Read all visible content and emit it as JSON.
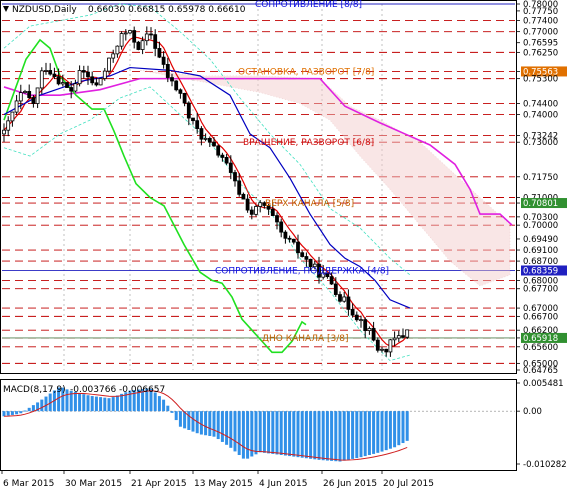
{
  "header": {
    "symbol": "NZDUSD,Daily",
    "ohlc": "0.66030 0.66815 0.65978 0.66610",
    "macd_label": "MACD(8,17,9)",
    "macd_values": "-0.003766 -0.006657"
  },
  "levels": [
    {
      "price": 0.78,
      "label": "0.78000",
      "text": "СОПРОТИВЛЕНИЕ [8/8]",
      "color": "#1010e0"
    },
    {
      "price": 0.774,
      "label": "0.77400"
    },
    {
      "price": 0.77,
      "label": "0.77000"
    },
    {
      "price": 0.7625,
      "label": "0.76250"
    },
    {
      "price": 0.7556,
      "label": "0.75563",
      "text": "ОСТАНОВКА, РАЗВОРОТ [7/8]",
      "color": "#e07000"
    },
    {
      "price": 0.753,
      "label": "0.75300"
    },
    {
      "price": 0.744,
      "label": "0.74400"
    },
    {
      "price": 0.74,
      "label": "0.74000"
    },
    {
      "price": 0.7324,
      "label": "0.73242"
    },
    {
      "price": 0.73,
      "label": "0.73000",
      "text": "ВРАЩЕНИЕ, РАЗВОРОТ [6/8]",
      "color": "#d01010"
    },
    {
      "price": 0.7175,
      "label": "0.71750"
    },
    {
      "price": 0.71,
      "label": "0.71000"
    },
    {
      "price": 0.708,
      "label": "0.70801",
      "text": "ВЕРХ КАНАЛА [5/8]",
      "color": "#c06000"
    },
    {
      "price": 0.703,
      "label": "0.70300"
    },
    {
      "price": 0.7,
      "label": "0.70000"
    },
    {
      "price": 0.691,
      "label": "0.69100"
    },
    {
      "price": 0.687,
      "label": "0.68700"
    },
    {
      "price": 0.6836,
      "label": "0.68359",
      "text": "СОПРОТИВЛЕНИЕ, ПОДДЕРЖКА [4/8]",
      "color": "#1010e0"
    },
    {
      "price": 0.68,
      "label": "0.68000"
    },
    {
      "price": 0.677,
      "label": "0.67700"
    },
    {
      "price": 0.67,
      "label": "0.67000"
    },
    {
      "price": 0.667,
      "label": "0.66700"
    },
    {
      "price": 0.662,
      "label": "0.66200"
    },
    {
      "price": 0.6592,
      "label": "0.65918",
      "text": "ДНО КАНАЛА [3/8]",
      "color": "#c06000"
    },
    {
      "price": 0.656,
      "label": "0.65600"
    },
    {
      "price": 0.65,
      "label": "0.65000"
    }
  ],
  "price_ticks": [
    {
      "price": 0.7775,
      "label": "0.77750"
    },
    {
      "price": 0.766,
      "label": "0.76595"
    },
    {
      "price": 0.695,
      "label": "0.69490"
    },
    {
      "price": 0.6476,
      "label": "0.64765"
    }
  ],
  "macd_ticks": [
    {
      "value": 0.005481,
      "label": "0.005481"
    },
    {
      "value": 0.0,
      "label": "0.00"
    },
    {
      "value": -0.010282,
      "label": "-0.010282"
    }
  ],
  "date_labels": [
    "6 Mar 2015",
    "30 Mar 2015",
    "21 Apr 2015",
    "13 May 2015",
    "4 Jun 2015",
    "26 Jun 2015",
    "20 Jul 2015"
  ],
  "colors": {
    "bg": "#ffffff",
    "candle": "#000000",
    "level_line": "#c00000",
    "magenta": "#e020e0",
    "green": "#20e020",
    "red_ma": "#e00000",
    "blue_ma": "#0000c0",
    "envelope": "#40e0c0",
    "macd_bar": "#3090e8",
    "signal": "#d02020",
    "current_price": "#508050"
  }
}
